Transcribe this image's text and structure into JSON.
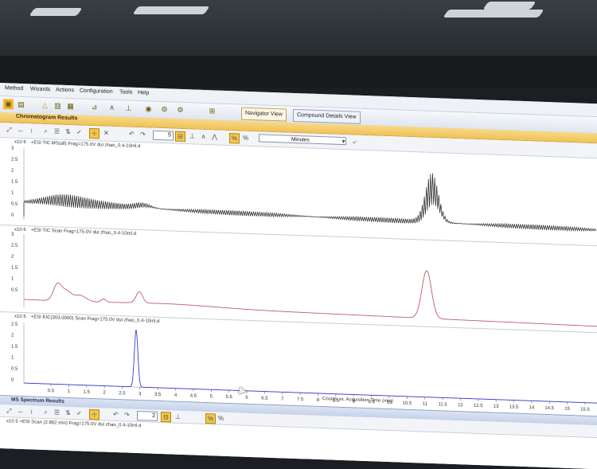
{
  "menu": [
    "Method",
    "Wizards",
    "Actions",
    "Configuration",
    "Tools",
    "Help"
  ],
  "toolbar": {
    "navigator_view": "Navigator View",
    "compound_details_view": "Compound Details View"
  },
  "chromatogram_panel": {
    "title": "Chromatogram Results",
    "spin_value": "5",
    "units_value": "Minutes"
  },
  "plots": [
    {
      "scale": "x10 6",
      "title": "+ESI TIC MS(all) Frag=175.0V dui zhao_0.4-10ml.d",
      "yticks": [
        "3",
        "2.5",
        "2",
        "1.5",
        "1",
        "0.5",
        "0"
      ],
      "color": "#222222"
    },
    {
      "scale": "x10 6",
      "title": "+ESI TIC Scan Frag=175.0V dui zhao_0.4-10ml.d",
      "yticks": [
        "3",
        "2.5",
        "2",
        "1.5",
        "1",
        "0.5"
      ],
      "color": "#c05a6a"
    },
    {
      "scale": "x10 5",
      "title": "+ESI EIC(303.0000) Scan Frag=175.0V dui zhao_0.4-10ml.d",
      "yticks": [
        "2.5",
        "2",
        "1.5",
        "1",
        "0.5",
        "0"
      ],
      "color": "#3a3ad0"
    }
  ],
  "xaxis": {
    "ticks": [
      "0.5",
      "1",
      "1.5",
      "2",
      "2.5",
      "3",
      "3.5",
      "4",
      "4.5",
      "5",
      "5.5",
      "6",
      "6.5",
      "7",
      "7.5",
      "8",
      "8.5",
      "9",
      "9.5",
      "10",
      "10.5",
      "11",
      "11.5",
      "12",
      "12.5",
      "13",
      "13.5",
      "14",
      "14.5",
      "15",
      "15.5"
    ],
    "label": "Counts vs. Acquisition Time (min)"
  },
  "ms_panel": {
    "title": "MS Spectrum Results",
    "spin_value": "2",
    "scan_title": "x10 5  +ESI Scan (2.862 min) Frag=175.0V dui zhao_0.4-10ml.d"
  },
  "colors": {
    "accent": "#f0c257",
    "ms_bar": "#c6d2ea"
  }
}
